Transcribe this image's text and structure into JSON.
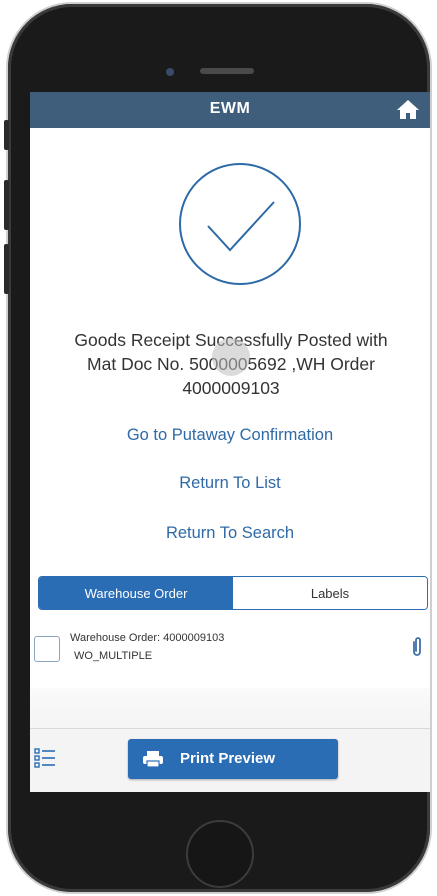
{
  "header": {
    "title": "EWM",
    "home_icon": "home-icon"
  },
  "status": {
    "icon": "checkmark-circle-icon",
    "message_line1": "Goods Receipt Successfully Posted with",
    "message_line2": "Mat Doc No. 5000005692 ,WH Order",
    "message_line3": "4000009103"
  },
  "actions": {
    "putaway": "Go to Putaway Confirmation",
    "return_list": "Return To List",
    "return_search": "Return To Search"
  },
  "tabs": [
    {
      "label": "Warehouse Order",
      "active": true
    },
    {
      "label": "Labels",
      "active": false
    }
  ],
  "list": {
    "items": [
      {
        "line1": "Warehouse Order: 4000009103",
        "line2": "WO_MULTIPLE",
        "icon": "paperclip-icon"
      }
    ]
  },
  "footer": {
    "print_label": "Print Preview",
    "print_icon": "printer-icon",
    "menu_icon": "list-icon"
  },
  "colors": {
    "header": "#3f5e7c",
    "accent": "#2a6db5",
    "link": "#2e6aa6"
  }
}
